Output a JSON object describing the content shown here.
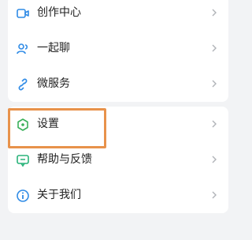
{
  "menu": {
    "group1": [
      {
        "label": "创作中心",
        "icon": "video-camera-icon"
      },
      {
        "label": "一起聊",
        "icon": "people-chat-icon"
      },
      {
        "label": "微服务",
        "icon": "link-chain-icon"
      }
    ],
    "group2": [
      {
        "label": "设置",
        "icon": "settings-hexagon-icon"
      },
      {
        "label": "帮助与反馈",
        "icon": "help-feedback-icon"
      },
      {
        "label": "关于我们",
        "icon": "info-icon"
      }
    ]
  },
  "colors": {
    "accent_icon": "#2f8be6",
    "settings_icon": "#3ab05a",
    "help_icon": "#29b37a",
    "highlight_border": "#e8924b",
    "background": "#f2f3f5"
  }
}
